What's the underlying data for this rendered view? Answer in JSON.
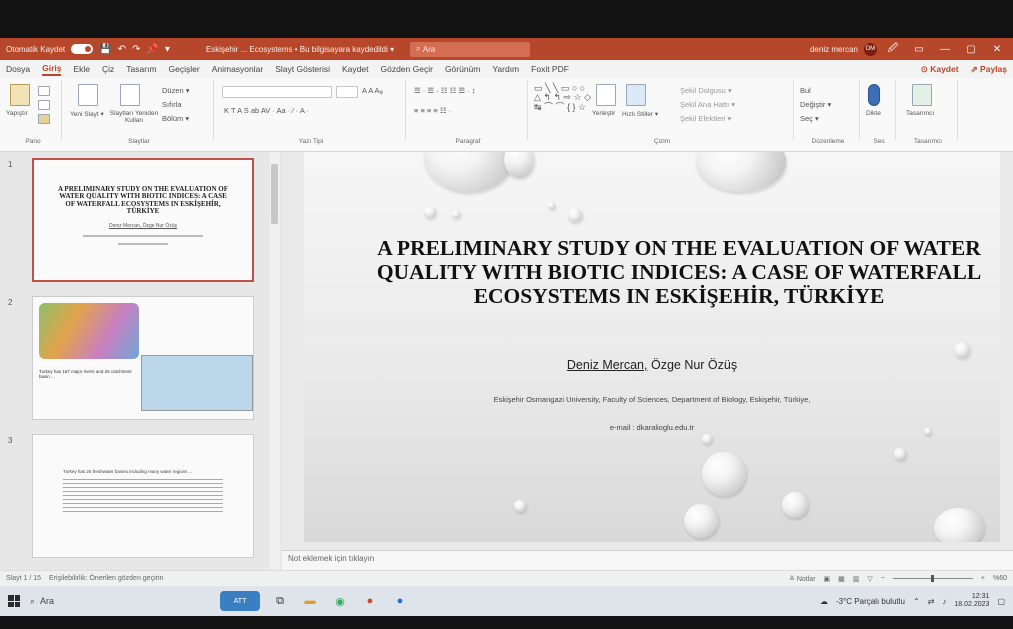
{
  "titlebar": {
    "autosave_label": "Otomatik Kaydet",
    "qat": [
      "💾",
      "↶",
      "↷",
      "📌",
      "▾"
    ],
    "filename": "Eskişehir ... Ecosystems • Bu bilgisayara kaydedildi ▾",
    "search_placeholder": "Ara",
    "user_name": "deniz mercan",
    "user_initials": "DM",
    "win_buttons": [
      "🖉",
      "▭",
      "—",
      "▢",
      "✕"
    ]
  },
  "menu": {
    "tabs": [
      "Dosya",
      "Giriş",
      "Ekle",
      "Çiz",
      "Tasarım",
      "Geçişler",
      "Animasyonlar",
      "Slayt Gösterisi",
      "Kaydet",
      "Gözden Geçir",
      "Görünüm",
      "Yardım",
      "Foxit PDF"
    ],
    "active_index": 1,
    "save_label": "⊙ Kaydet",
    "share_label": "⇗ Paylaş"
  },
  "ribbon": {
    "groups": [
      "Pano",
      "Slaytlar",
      "Yazı Tipi",
      "Paragraf",
      "Çizim",
      "Düzenleme",
      "Ses",
      "Tasarımcı"
    ],
    "paste": "Yapıştır",
    "new_slide": "Yeni Slayt ▾",
    "reuse_slides": "Slaytları Yeniden Kullan",
    "layout": "Düzen ▾",
    "reset": "Sıfırla",
    "section": "Bölüm ▾",
    "arrange": "Yerleştir",
    "quick_styles": "Hızlı Stiller ▾",
    "shape_fill": "Şekil Dolgusu ▾",
    "shape_outline": "Şekil Ana Hattı ▾",
    "shape_effects": "Şekil Efektleri ▾",
    "find": "Bul",
    "replace": "Değiştir ▾",
    "select": "Seç ▾",
    "dictate": "Dikte",
    "designer": "Tasarımcı"
  },
  "thumbnails": [
    {
      "num": "1",
      "title": "A PRELIMINARY STUDY ON THE EVALUATION OF WATER QUALITY WITH BIOTIC INDICES: A CASE OF WATERFALL ECOSYSTEMS IN ESKİŞEHİR, TÜRKİYE",
      "authors": "Deniz Mercan, Özge Nur Özüş"
    },
    {
      "num": "2",
      "text": "Turkey has 187 major rivers and 25 catchment basin ..."
    },
    {
      "num": "3",
      "text": "Turkey has 25 freshwater basins including many water regions ..."
    }
  ],
  "slide": {
    "title": "A PRELIMINARY STUDY ON THE EVALUATION OF WATER QUALITY WITH BIOTIC INDICES: A CASE OF WATERFALL ECOSYSTEMS IN ESKİŞEHİR, TÜRKİYE",
    "author1": "Deniz Mercan,",
    "author2": "Özge Nur Özüş",
    "affiliation": "Eskişehir Osmangazi University, Faculty of Sciences, Department of Biology, Eskişehir, Türkiye,",
    "email": "e-mail : dkaralioglu.edu.tr"
  },
  "notes_placeholder": "Not eklemek için tıklayın",
  "status": {
    "slide_counter": "Slayt 1 / 15",
    "accessibility": "Erişilebilirlik: Önerilen gözden geçirin",
    "notes_btn": "≙ Notlar",
    "zoom": "%60"
  },
  "taskbar": {
    "search": "Ara",
    "weather": "-3°C Parçalı bulutlu",
    "time": "12:31",
    "date": "18.02.2023"
  }
}
